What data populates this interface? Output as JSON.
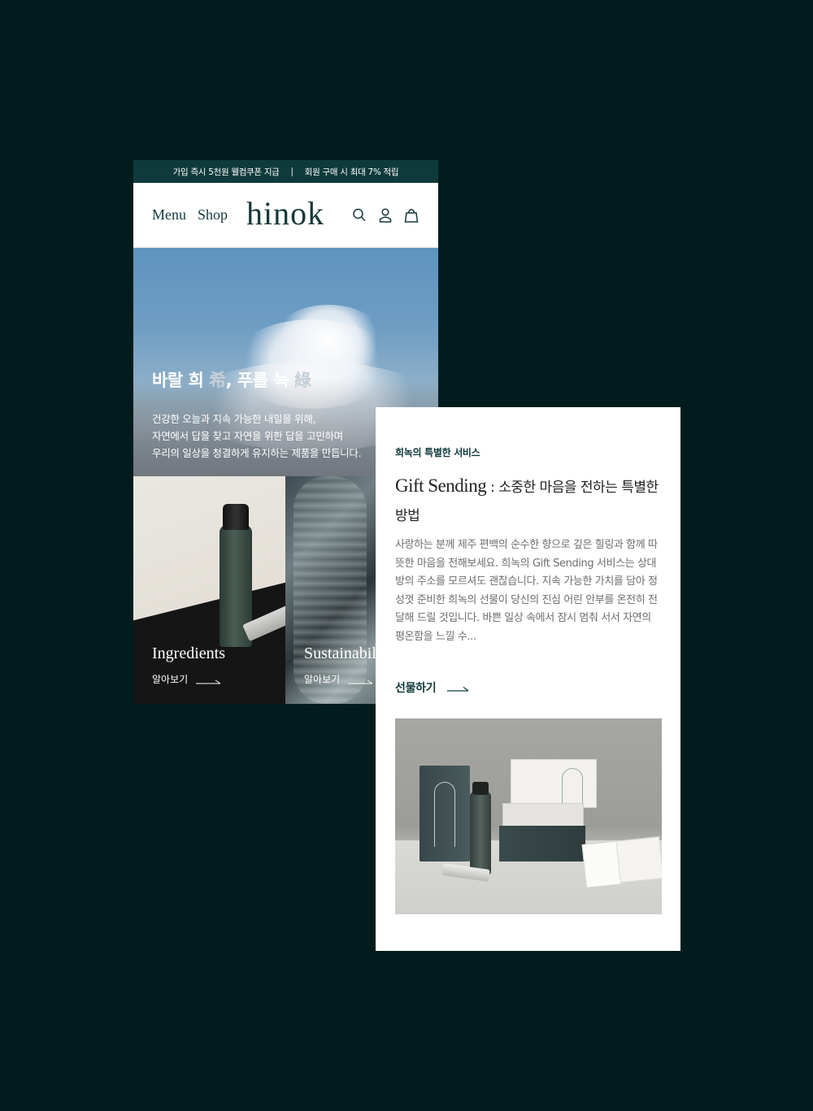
{
  "promo": {
    "left": "가입 즉시 5천원 웰컴쿠폰 지급",
    "separator": "|",
    "right": "회원 구매 시 최대 7% 적립"
  },
  "nav": {
    "menu": "Menu",
    "shop": "Shop",
    "logo": "hinok",
    "icons": [
      "search-icon",
      "account-icon",
      "bag-icon"
    ]
  },
  "hero": {
    "headline_a": "바랄 희 ",
    "headline_hanja_a": "希",
    "headline_b": ", 푸를 녹 ",
    "headline_hanja_b": "綠",
    "lines": [
      "건강한 오늘과 지속 가능한 내일을 위해,",
      "자연에서 답을 찾고 자연을 위한 답을 고민하며",
      "우리의 일상을 청결하게 유지하는 제품을 만듭니다."
    ]
  },
  "tiles": [
    {
      "title": "Ingredients",
      "link": "알아보기"
    },
    {
      "title": "Sustainability",
      "link": "알아보기"
    }
  ],
  "gift": {
    "eyebrow": "희녹의 특별한 서비스",
    "title_en": "Gift Sending",
    "title_ko": " : 소중한 마음을 전하는 특별한 방법",
    "description": "사랑하는 분께 제주 편백의 순수한 향으로 깊은 힐링과 함께 따뜻한 마음을 전해보세요. 희녹의 Gift Sending 서비스는 상대방의 주소를 모르셔도 괜찮습니다. 지속 가능한 가치를 담아 정성껏 준비한 희녹의 선물이 당신의 진심 어린 안부를 온전히 전달해 드릴 것입니다. 바쁜 일상 속에서 잠시 멈춰 서서 자연의 평온함을 느낄 수...",
    "cta": "선물하기"
  },
  "colors": {
    "background": "#021c1d",
    "brand_dark": "#0f3a3b",
    "text_body": "#6e6e6e"
  }
}
